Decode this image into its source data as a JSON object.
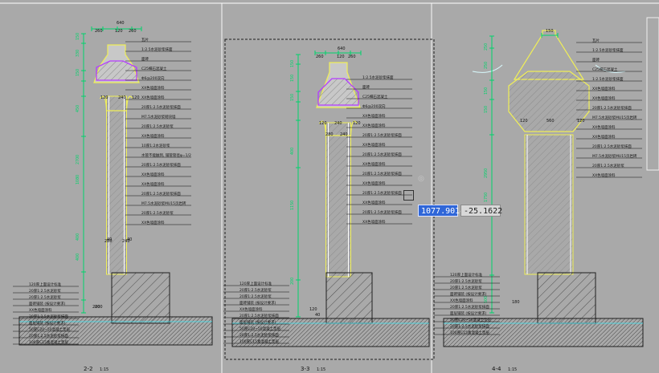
{
  "coordinate_readout": {
    "x": "1077.9014",
    "y": "-25.1622"
  },
  "views": [
    {
      "id": "2-2",
      "title_number": "2-2",
      "scale": "1:15",
      "top_dims": [
        "640",
        "260",
        "120",
        "260"
      ],
      "left_dims": [
        "150",
        "330",
        "150",
        "450",
        "2700",
        "1080",
        "400",
        "400"
      ],
      "inner_dims": [
        "120",
        "240",
        "120",
        "280",
        "240",
        "200",
        "40",
        "40",
        "200"
      ],
      "labels": [
        "瓦片",
        "1:2.5水泥砂浆抹面",
        "面砖",
        "C25细石混凝土",
        "Φ6@200双向",
        "XX色墙面涂料",
        "XX色墙面涂料",
        "20厚1:2.5水泥砂浆抹面",
        "M7.5水泥砂浆砌块墙",
        "20厚1:2.5水泥砂浆",
        "XX色墙面涂料",
        "10厚1:2水泥砂浆",
        "水管不能触到, 铺管管径φ=1/2",
        "20厚1:2.5水泥砂浆抹面",
        "XX色墙面涂料",
        "XX色墙面涂料",
        "20厚1:2.5水泥砂浆抹面",
        "M7.5水泥砂浆MU15页岩砖",
        "20厚1:2.5水泥砂浆",
        "XX色墙面涂料",
        "120厚上面设计标准",
        "20厚1:2.5水泥砂浆",
        "20厚1:2.5水泥砂浆",
        "面砖铺装 (按设计要求)",
        "XX色墙面涂料",
        "20厚1:2.5水泥砂浆抹面",
        "面层铺装 (按设计要求)",
        "50厚C20~50混凝土垫层",
        "20厚1:2.5水泥砂浆抹面",
        "100厚C15素混凝土垫层"
      ]
    },
    {
      "id": "3-3",
      "title_number": "3-3",
      "scale": "1:15",
      "top_dims": [
        "640",
        "260",
        "120",
        "260"
      ],
      "left_dims": [
        "150",
        "150",
        "150",
        "400",
        "1150",
        "200"
      ],
      "inner_dims": [
        "120",
        "240",
        "120",
        "280",
        "240",
        "120",
        "40"
      ],
      "labels": [
        "1:2.5水泥砂浆抹面",
        "面砖",
        "C25细石混凝土",
        "Φ6@200双向",
        "XX色墙面涂料",
        "XX色墙面涂料",
        "20厚1:2.5水泥砂浆抹面",
        "XX色墙面涂料",
        "20厚1:2.5水泥砂浆抹面",
        "XX色墙面涂料",
        "20厚1:2.5水泥砂浆抹面",
        "XX色墙面涂料",
        "20厚1:2.5水泥砂浆抹面",
        "XX色墙面涂料",
        "20厚1:2.5水泥砂浆抹面",
        "XX色墙面涂料",
        "120厚上面设计标准",
        "20厚1:2.5水泥砂浆",
        "20厚1:2.5水泥砂浆",
        "面砖铺装 (按设计要求)",
        "XX色墙面涂料",
        "20厚1:2.5水泥砂浆抹面",
        "面层铺装 (按设计要求)",
        "50厚C20~50混凝土垫层",
        "20厚1:2.5水泥砂浆抹面",
        "100厚C15素混凝土垫层"
      ]
    },
    {
      "id": "4-4",
      "title_number": "4-4",
      "scale": "1:15",
      "top_dims": [
        "150"
      ],
      "left_dims": [
        "250",
        "250",
        "150",
        "150",
        "2950",
        "1750",
        "500"
      ],
      "inner_dims": [
        "120",
        "560",
        "120",
        "180"
      ],
      "labels": [
        "瓦片",
        "1:2.5水泥砂浆抹面",
        "面砖",
        "C25细石混凝土",
        "1:2.5水泥砂浆抹面",
        "XX色墙面涂料",
        "XX色墙面涂料",
        "20厚1:2.5水泥砂浆抹面",
        "M7.5水泥砂浆MU15页岩砖",
        "XX色墙面涂料",
        "XX色墙面涂料",
        "20厚1:2.5水泥砂浆抹面",
        "M7.5水泥砂浆MU15页岩砖",
        "20厚1:2.5水泥砂浆",
        "XX色墙面涂料",
        "120厚上面设计标准",
        "20厚1:2.5水泥砂浆",
        "20厚1:2.5水泥砂浆",
        "面砖铺装 (按设计要求)",
        "XX色墙面涂料",
        "20厚1:2.5水泥砂浆抹面",
        "面层铺装 (按设计要求)",
        "50厚C20~50混凝土垫层",
        "20厚1:2.5水泥砂浆抹面",
        "100厚C15素混凝土垫层"
      ]
    }
  ],
  "colors": {
    "background": "#a9a9a9",
    "dimension": "#00d36a",
    "line": "#ffffff",
    "yellow": "#f0ef58",
    "cyan": "#36e7f5",
    "magenta": "#b43cff",
    "dark": "#1e1e1e",
    "selection": "#3367d6"
  }
}
